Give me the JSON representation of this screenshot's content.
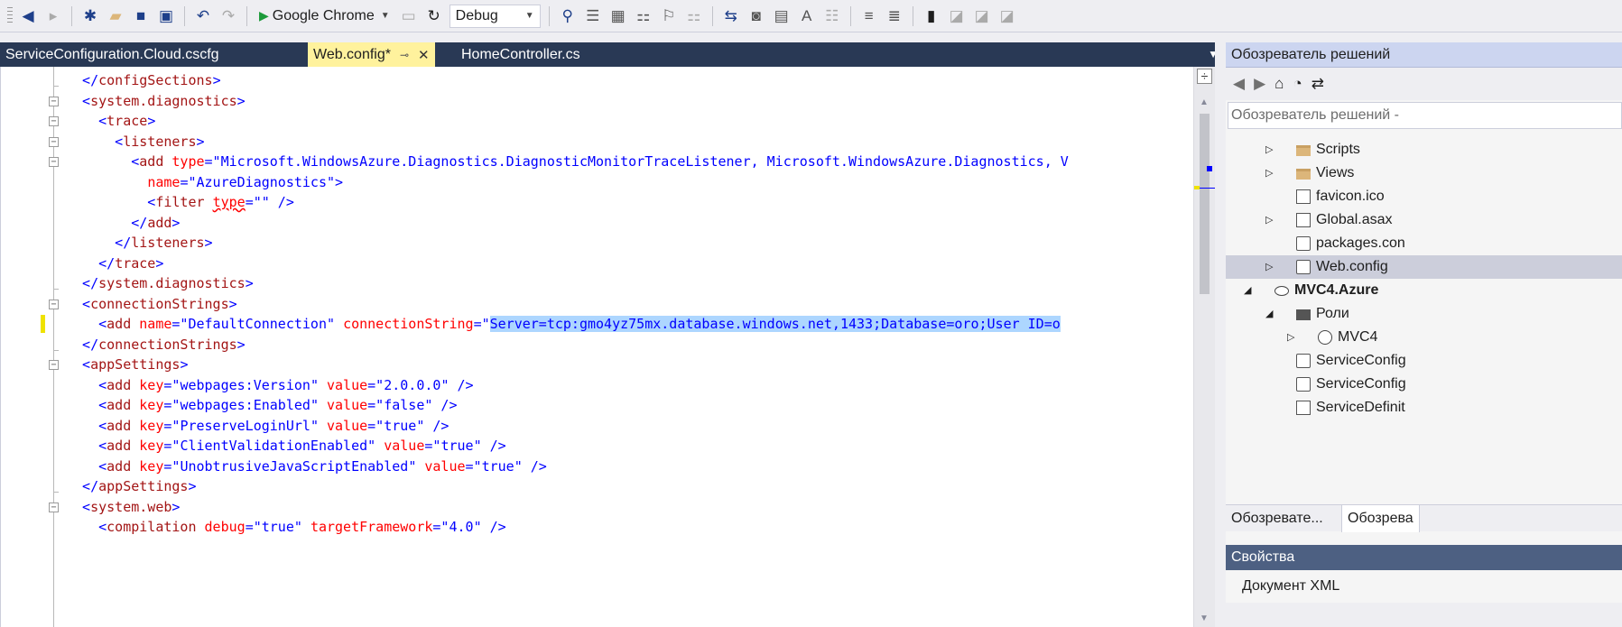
{
  "toolbar": {
    "run_target": "Google Chrome",
    "configuration": "Debug",
    "icons": [
      "back-icon",
      "forward-icon",
      "new-project-icon",
      "open-icon",
      "save-icon",
      "save-all-icon",
      "undo-icon",
      "redo-icon",
      "start-icon",
      "refresh-icon",
      "find-icon",
      "comment-icon",
      "bookmark-icon"
    ]
  },
  "tabs": [
    {
      "label": "ServiceConfiguration.Cloud.cscfg",
      "active": false
    },
    {
      "label": "Web.config*",
      "active": true
    },
    {
      "label": "HomeController.cs",
      "active": false
    }
  ],
  "editor": {
    "lines": [
      [
        [
          "t",
          "  </"
        ],
        [
          "tn",
          "configSections"
        ],
        [
          "t",
          ">"
        ]
      ],
      [
        [
          "t",
          "  <"
        ],
        [
          "tn",
          "system.diagnostics"
        ],
        [
          "t",
          ">"
        ]
      ],
      [
        [
          "t",
          "    <"
        ],
        [
          "tn",
          "trace"
        ],
        [
          "t",
          ">"
        ]
      ],
      [
        [
          "t",
          "      <"
        ],
        [
          "tn",
          "listeners"
        ],
        [
          "t",
          ">"
        ]
      ],
      [
        [
          "t",
          "        <"
        ],
        [
          "tn",
          "add"
        ],
        [
          "tx",
          " "
        ],
        [
          "an",
          "type"
        ],
        [
          "t",
          "=\""
        ],
        [
          "av",
          "Microsoft.WindowsAzure.Diagnostics.DiagnosticMonitorTraceListener, Microsoft.WindowsAzure.Diagnostics, V"
        ]
      ],
      [
        [
          "tx",
          "          "
        ],
        [
          "an",
          "name"
        ],
        [
          "t",
          "=\""
        ],
        [
          "av",
          "AzureDiagnostics"
        ],
        [
          "t",
          "\">"
        ]
      ],
      [
        [
          "t",
          "          <"
        ],
        [
          "tn",
          "filter"
        ],
        [
          "tx",
          " "
        ],
        [
          "an squig",
          "type"
        ],
        [
          "t",
          "=\"\" />"
        ]
      ],
      [
        [
          "t",
          "        </"
        ],
        [
          "tn",
          "add"
        ],
        [
          "t",
          ">"
        ]
      ],
      [
        [
          "t",
          "      </"
        ],
        [
          "tn",
          "listeners"
        ],
        [
          "t",
          ">"
        ]
      ],
      [
        [
          "t",
          "    </"
        ],
        [
          "tn",
          "trace"
        ],
        [
          "t",
          ">"
        ]
      ],
      [
        [
          "t",
          "  </"
        ],
        [
          "tn",
          "system.diagnostics"
        ],
        [
          "t",
          ">"
        ]
      ],
      [
        [
          "t",
          "  <"
        ],
        [
          "tn",
          "connectionStrings"
        ],
        [
          "t",
          ">"
        ]
      ],
      [
        [
          "t",
          "    <"
        ],
        [
          "tn",
          "add"
        ],
        [
          "tx",
          " "
        ],
        [
          "an",
          "name"
        ],
        [
          "t",
          "=\""
        ],
        [
          "av",
          "DefaultConnection"
        ],
        [
          "t",
          "\""
        ],
        [
          "tx",
          " "
        ],
        [
          "an",
          "connectionString"
        ],
        [
          "t",
          "=\""
        ],
        [
          "av sel",
          "Server=tcp:gmo4yz75mx.database.windows.net,1433;Database=oro;User ID=o"
        ]
      ],
      [
        [
          "t",
          "  </"
        ],
        [
          "tn",
          "connectionStrings"
        ],
        [
          "t",
          ">"
        ]
      ],
      [
        [
          "t",
          "  <"
        ],
        [
          "tn",
          "appSettings"
        ],
        [
          "t",
          ">"
        ]
      ],
      [
        [
          "t",
          "    <"
        ],
        [
          "tn",
          "add"
        ],
        [
          "tx",
          " "
        ],
        [
          "an",
          "key"
        ],
        [
          "t",
          "=\""
        ],
        [
          "av",
          "webpages:Version"
        ],
        [
          "t",
          "\""
        ],
        [
          "tx",
          " "
        ],
        [
          "an",
          "value"
        ],
        [
          "t",
          "=\""
        ],
        [
          "av",
          "2.0.0.0"
        ],
        [
          "t",
          "\" />"
        ]
      ],
      [
        [
          "t",
          "    <"
        ],
        [
          "tn",
          "add"
        ],
        [
          "tx",
          " "
        ],
        [
          "an",
          "key"
        ],
        [
          "t",
          "=\""
        ],
        [
          "av",
          "webpages:Enabled"
        ],
        [
          "t",
          "\""
        ],
        [
          "tx",
          " "
        ],
        [
          "an",
          "value"
        ],
        [
          "t",
          "=\""
        ],
        [
          "av",
          "false"
        ],
        [
          "t",
          "\" />"
        ]
      ],
      [
        [
          "t",
          "    <"
        ],
        [
          "tn",
          "add"
        ],
        [
          "tx",
          " "
        ],
        [
          "an",
          "key"
        ],
        [
          "t",
          "=\""
        ],
        [
          "av",
          "PreserveLoginUrl"
        ],
        [
          "t",
          "\""
        ],
        [
          "tx",
          " "
        ],
        [
          "an",
          "value"
        ],
        [
          "t",
          "=\""
        ],
        [
          "av",
          "true"
        ],
        [
          "t",
          "\" />"
        ]
      ],
      [
        [
          "t",
          "    <"
        ],
        [
          "tn",
          "add"
        ],
        [
          "tx",
          " "
        ],
        [
          "an",
          "key"
        ],
        [
          "t",
          "=\""
        ],
        [
          "av",
          "ClientValidationEnabled"
        ],
        [
          "t",
          "\""
        ],
        [
          "tx",
          " "
        ],
        [
          "an",
          "value"
        ],
        [
          "t",
          "=\""
        ],
        [
          "av",
          "true"
        ],
        [
          "t",
          "\" />"
        ]
      ],
      [
        [
          "t",
          "    <"
        ],
        [
          "tn",
          "add"
        ],
        [
          "tx",
          " "
        ],
        [
          "an",
          "key"
        ],
        [
          "t",
          "=\""
        ],
        [
          "av",
          "UnobtrusiveJavaScriptEnabled"
        ],
        [
          "t",
          "\""
        ],
        [
          "tx",
          " "
        ],
        [
          "an",
          "value"
        ],
        [
          "t",
          "=\""
        ],
        [
          "av",
          "true"
        ],
        [
          "t",
          "\" />"
        ]
      ],
      [
        [
          "t",
          "  </"
        ],
        [
          "tn",
          "appSettings"
        ],
        [
          "t",
          ">"
        ]
      ],
      [
        [
          "t",
          "  <"
        ],
        [
          "tn",
          "system.web"
        ],
        [
          "t",
          ">"
        ]
      ],
      [
        [
          "t",
          "    <"
        ],
        [
          "tn",
          "compilation"
        ],
        [
          "tx",
          " "
        ],
        [
          "an",
          "debug"
        ],
        [
          "t",
          "=\""
        ],
        [
          "av",
          "true"
        ],
        [
          "t",
          "\""
        ],
        [
          "tx",
          " "
        ],
        [
          "an",
          "targetFramework"
        ],
        [
          "t",
          "=\""
        ],
        [
          "av",
          "4.0"
        ],
        [
          "t",
          "\" />"
        ]
      ]
    ],
    "folds": [
      1,
      2,
      3,
      4,
      11,
      14,
      21
    ],
    "changed_line": 12
  },
  "solution_explorer": {
    "title": "Обозреватель решений",
    "search_placeholder": "Обозреватель решений -",
    "items": [
      {
        "label": "Scripts",
        "icon": "folder-icon",
        "expander": "▷",
        "indent": 1
      },
      {
        "label": "Views",
        "icon": "folder-icon",
        "expander": "▷",
        "indent": 1
      },
      {
        "label": "favicon.ico",
        "icon": "file-icon",
        "expander": "",
        "indent": 1
      },
      {
        "label": "Global.asax",
        "icon": "file-icon",
        "expander": "▷",
        "indent": 1
      },
      {
        "label": "packages.con",
        "icon": "config-icon",
        "expander": "",
        "indent": 1
      },
      {
        "label": "Web.config",
        "icon": "config-icon",
        "expander": "▷",
        "indent": 1,
        "selected": true
      },
      {
        "label": "MVC4.Azure",
        "icon": "cloud-icon",
        "expander": "◢",
        "indent": 0,
        "bold": true
      },
      {
        "label": "Роли",
        "icon": "roles-icon",
        "expander": "◢",
        "indent": 1
      },
      {
        "label": "MVC4",
        "icon": "globe-icon",
        "expander": "▷",
        "indent": 2
      },
      {
        "label": "ServiceConfig",
        "icon": "config-icon",
        "expander": "",
        "indent": 1
      },
      {
        "label": "ServiceConfig",
        "icon": "config-icon",
        "expander": "",
        "indent": 1
      },
      {
        "label": "ServiceDefinit",
        "icon": "file-icon",
        "expander": "",
        "indent": 1
      }
    ],
    "bottom_tabs": [
      "Обозревате...",
      "Обозрева"
    ]
  },
  "properties": {
    "title": "Свойства",
    "object": "Документ XML"
  }
}
